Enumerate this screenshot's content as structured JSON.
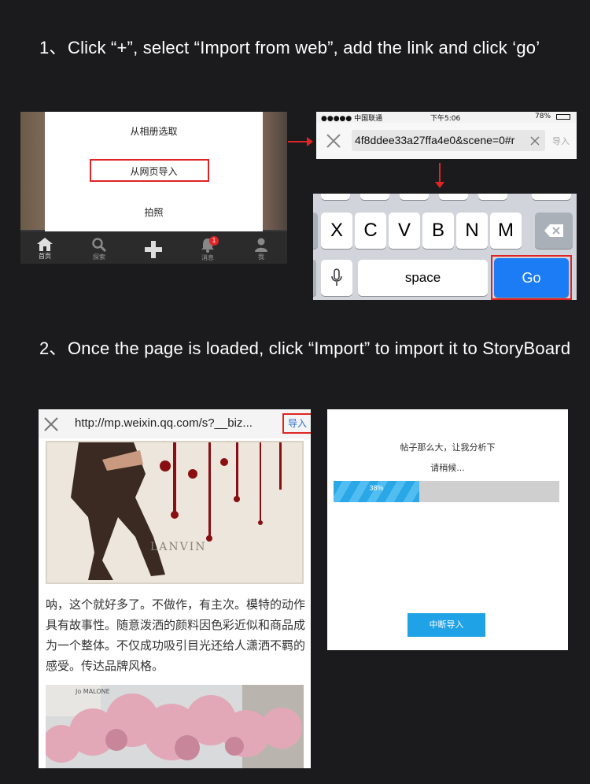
{
  "steps": [
    {
      "number": "1、",
      "text": "Click “+”, select “Import from web”, add the link and click ‘go’"
    },
    {
      "number": "2、",
      "text": "Once the page is loaded, click “Import” to import it to StoryBoard"
    }
  ],
  "app_menu": {
    "options": [
      "从相册选取",
      "从网页导入",
      "拍照"
    ],
    "tabs": [
      {
        "label": "首页",
        "icon": "home-icon"
      },
      {
        "label": "探索",
        "icon": "search-icon"
      },
      {
        "label": "",
        "icon": "plus-icon"
      },
      {
        "label": "消息",
        "icon": "bell-icon",
        "badge": "1"
      },
      {
        "label": "我",
        "icon": "user-icon"
      }
    ]
  },
  "browser": {
    "carrier": "●●●●● 中国联通",
    "time": "下午5:06",
    "battery": "78%",
    "url": "4f8ddee33a27ffa4e0&scene=0#r",
    "import_label": "导入"
  },
  "keyboard": {
    "letters": [
      "X",
      "C",
      "V",
      "B",
      "N",
      "M"
    ],
    "space_label": "space",
    "go_label": "Go"
  },
  "article": {
    "url": "http://mp.weixin.qq.com/s?__biz...",
    "import_label": "导入",
    "brand_text": "LANVIN",
    "paragraph": "呐，这个就好多了。不做作，有主次。模特的动作具有故事性。随意泼洒的颜料因色彩近似和商品成为一个整体。不仅成功吸引目光还给人潇洒不羁的感受。传达品牌风格。",
    "photo2_sign": "Jo MALONE"
  },
  "progress": {
    "line1": "帖子那么大，让我分析下",
    "line2": "请稍候...",
    "percent_label": "38%",
    "percent": 0.38,
    "abort_label": "中断导入"
  },
  "colors": {
    "highlight": "#e02424",
    "go_blue": "#1b7cf6",
    "progress_blue": "#2aa7e6"
  }
}
